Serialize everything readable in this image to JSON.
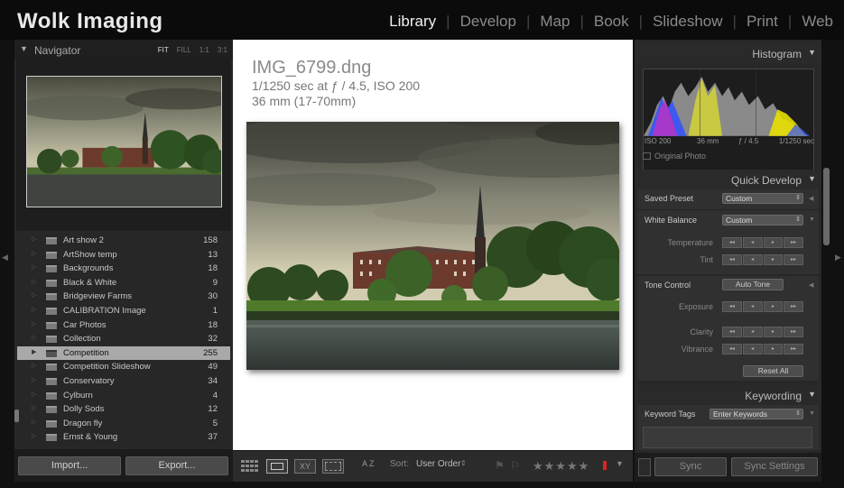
{
  "app": {
    "brand": "Wolk Imaging",
    "modules": [
      "Library",
      "Develop",
      "Map",
      "Book",
      "Slideshow",
      "Print",
      "Web"
    ],
    "active_module": "Library"
  },
  "navigator": {
    "title": "Navigator",
    "zoom_options": [
      "FIT",
      "FILL",
      "1:1",
      "3:1"
    ],
    "active_zoom": "FIT"
  },
  "folders": [
    {
      "name": "Art show 2",
      "count": "158"
    },
    {
      "name": "ArtShow temp",
      "count": "13"
    },
    {
      "name": "Backgrounds",
      "count": "18"
    },
    {
      "name": "Black & White",
      "count": "9"
    },
    {
      "name": "Bridgeview Farms",
      "count": "30"
    },
    {
      "name": "CALIBRATION Image",
      "count": "1"
    },
    {
      "name": "Car Photos",
      "count": "18"
    },
    {
      "name": "Collection",
      "count": "32"
    },
    {
      "name": "Competition",
      "count": "255",
      "selected": true
    },
    {
      "name": "Competition Slideshow",
      "count": "49"
    },
    {
      "name": "Conservatory",
      "count": "34"
    },
    {
      "name": "Cylburn",
      "count": "4"
    },
    {
      "name": "Dolly Sods",
      "count": "12"
    },
    {
      "name": "Dragon fly",
      "count": "5"
    },
    {
      "name": "Ernst & Young",
      "count": "37"
    }
  ],
  "left_buttons": {
    "import": "Import...",
    "export": "Export..."
  },
  "photo_info": {
    "filename": "IMG_6799.dng",
    "exposure": "1/1250 sec at ƒ / 4.5, ISO 200",
    "lens": "36 mm (17-70mm)"
  },
  "toolbar": {
    "sort_label": "Sort:",
    "sort_value": "User Order",
    "az": "A Z"
  },
  "histogram": {
    "title": "Histogram",
    "iso": "ISO 200",
    "focal": "36 mm",
    "aperture": "ƒ / 4.5",
    "shutter": "1/1250 sec",
    "original_photo": "Original Photo"
  },
  "quick_develop": {
    "title": "Quick Develop",
    "saved_preset_label": "Saved Preset",
    "saved_preset_value": "Custom",
    "white_balance_label": "White Balance",
    "white_balance_value": "Custom",
    "temperature": "Temperature",
    "tint": "Tint",
    "tone_control": "Tone Control",
    "auto_tone": "Auto Tone",
    "exposure": "Exposure",
    "clarity": "Clarity",
    "vibrance": "Vibrance",
    "reset_all": "Reset All"
  },
  "keywording": {
    "title": "Keywording",
    "keyword_tags_label": "Keyword Tags",
    "keyword_tags_value": "Enter Keywords"
  },
  "right_buttons": {
    "sync": "Sync",
    "sync_settings": "Sync Settings"
  },
  "colors": {
    "selected_row": "#a9a9a9",
    "flag_red": "#d22",
    "histogram_yellow": "#e8e000",
    "histogram_blue": "#3050ff"
  }
}
